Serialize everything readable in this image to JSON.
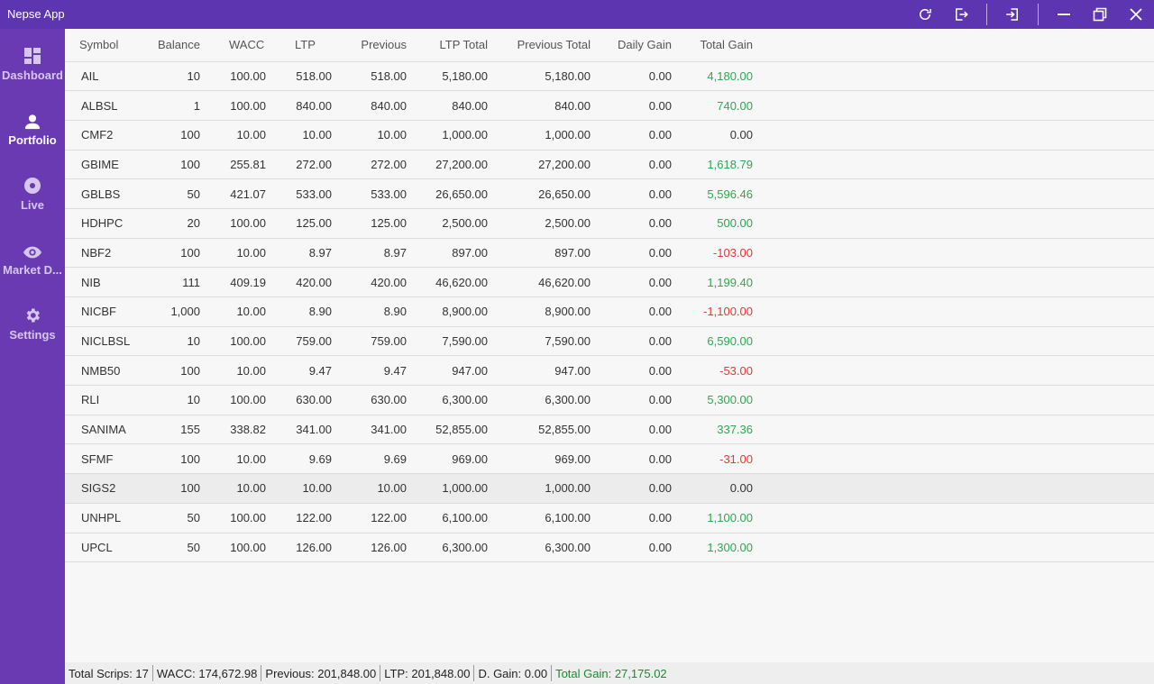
{
  "app": {
    "title": "Nepse App"
  },
  "colors": {
    "accent": "#5e35b1",
    "sidebar": "#6a3ab2",
    "positive": "#2fa84f",
    "negative": "#e53935"
  },
  "toolbar_icons": [
    "refresh-icon",
    "logout-icon",
    "login-icon",
    "minimize-icon",
    "restore-icon",
    "close-icon"
  ],
  "nav": [
    {
      "label": "Dashboard",
      "icon": "dashboard-icon",
      "active": false
    },
    {
      "label": "Portfolio",
      "icon": "person-icon",
      "active": true
    },
    {
      "label": "Live",
      "icon": "live-icon",
      "active": false
    },
    {
      "label": "Market D...",
      "icon": "eye-icon",
      "active": false
    },
    {
      "label": "Settings",
      "icon": "gear-icon",
      "active": false
    }
  ],
  "table": {
    "headers": [
      "Symbol",
      "Balance",
      "WACC",
      "LTP",
      "Previous",
      "LTP Total",
      "Previous Total",
      "Daily Gain",
      "Total Gain"
    ],
    "rows": [
      [
        "AIL",
        "10",
        "100.00",
        "518.00",
        "518.00",
        "5,180.00",
        "5,180.00",
        "0.00",
        "4,180.00"
      ],
      [
        "ALBSL",
        "1",
        "100.00",
        "840.00",
        "840.00",
        "840.00",
        "840.00",
        "0.00",
        "740.00"
      ],
      [
        "CMF2",
        "100",
        "10.00",
        "10.00",
        "10.00",
        "1,000.00",
        "1,000.00",
        "0.00",
        "0.00"
      ],
      [
        "GBIME",
        "100",
        "255.81",
        "272.00",
        "272.00",
        "27,200.00",
        "27,200.00",
        "0.00",
        "1,618.79"
      ],
      [
        "GBLBS",
        "50",
        "421.07",
        "533.00",
        "533.00",
        "26,650.00",
        "26,650.00",
        "0.00",
        "5,596.46"
      ],
      [
        "HDHPC",
        "20",
        "100.00",
        "125.00",
        "125.00",
        "2,500.00",
        "2,500.00",
        "0.00",
        "500.00"
      ],
      [
        "NBF2",
        "100",
        "10.00",
        "8.97",
        "8.97",
        "897.00",
        "897.00",
        "0.00",
        "-103.00"
      ],
      [
        "NIB",
        "111",
        "409.19",
        "420.00",
        "420.00",
        "46,620.00",
        "46,620.00",
        "0.00",
        "1,199.40"
      ],
      [
        "NICBF",
        "1,000",
        "10.00",
        "8.90",
        "8.90",
        "8,900.00",
        "8,900.00",
        "0.00",
        "-1,100.00"
      ],
      [
        "NICLBSL",
        "10",
        "100.00",
        "759.00",
        "759.00",
        "7,590.00",
        "7,590.00",
        "0.00",
        "6,590.00"
      ],
      [
        "NMB50",
        "100",
        "10.00",
        "9.47",
        "9.47",
        "947.00",
        "947.00",
        "0.00",
        "-53.00"
      ],
      [
        "RLI",
        "10",
        "100.00",
        "630.00",
        "630.00",
        "6,300.00",
        "6,300.00",
        "0.00",
        "5,300.00"
      ],
      [
        "SANIMA",
        "155",
        "338.82",
        "341.00",
        "341.00",
        "52,855.00",
        "52,855.00",
        "0.00",
        "337.36"
      ],
      [
        "SFMF",
        "100",
        "10.00",
        "9.69",
        "9.69",
        "969.00",
        "969.00",
        "0.00",
        "-31.00"
      ],
      [
        "SIGS2",
        "100",
        "10.00",
        "10.00",
        "10.00",
        "1,000.00",
        "1,000.00",
        "0.00",
        "0.00"
      ],
      [
        "UNHPL",
        "50",
        "100.00",
        "122.00",
        "122.00",
        "6,100.00",
        "6,100.00",
        "0.00",
        "1,100.00"
      ],
      [
        "UPCL",
        "50",
        "100.00",
        "126.00",
        "126.00",
        "6,300.00",
        "6,300.00",
        "0.00",
        "1,300.00"
      ]
    ],
    "hover_row": 14
  },
  "status": {
    "total_scrips": "Total Scrips: 17",
    "wacc": "WACC: 174,672.98",
    "previous": "Previous: 201,848.00",
    "ltp": "LTP: 201,848.00",
    "d_gain": "D. Gain: 0.00",
    "total_gain": "Total Gain: 27,175.02"
  }
}
